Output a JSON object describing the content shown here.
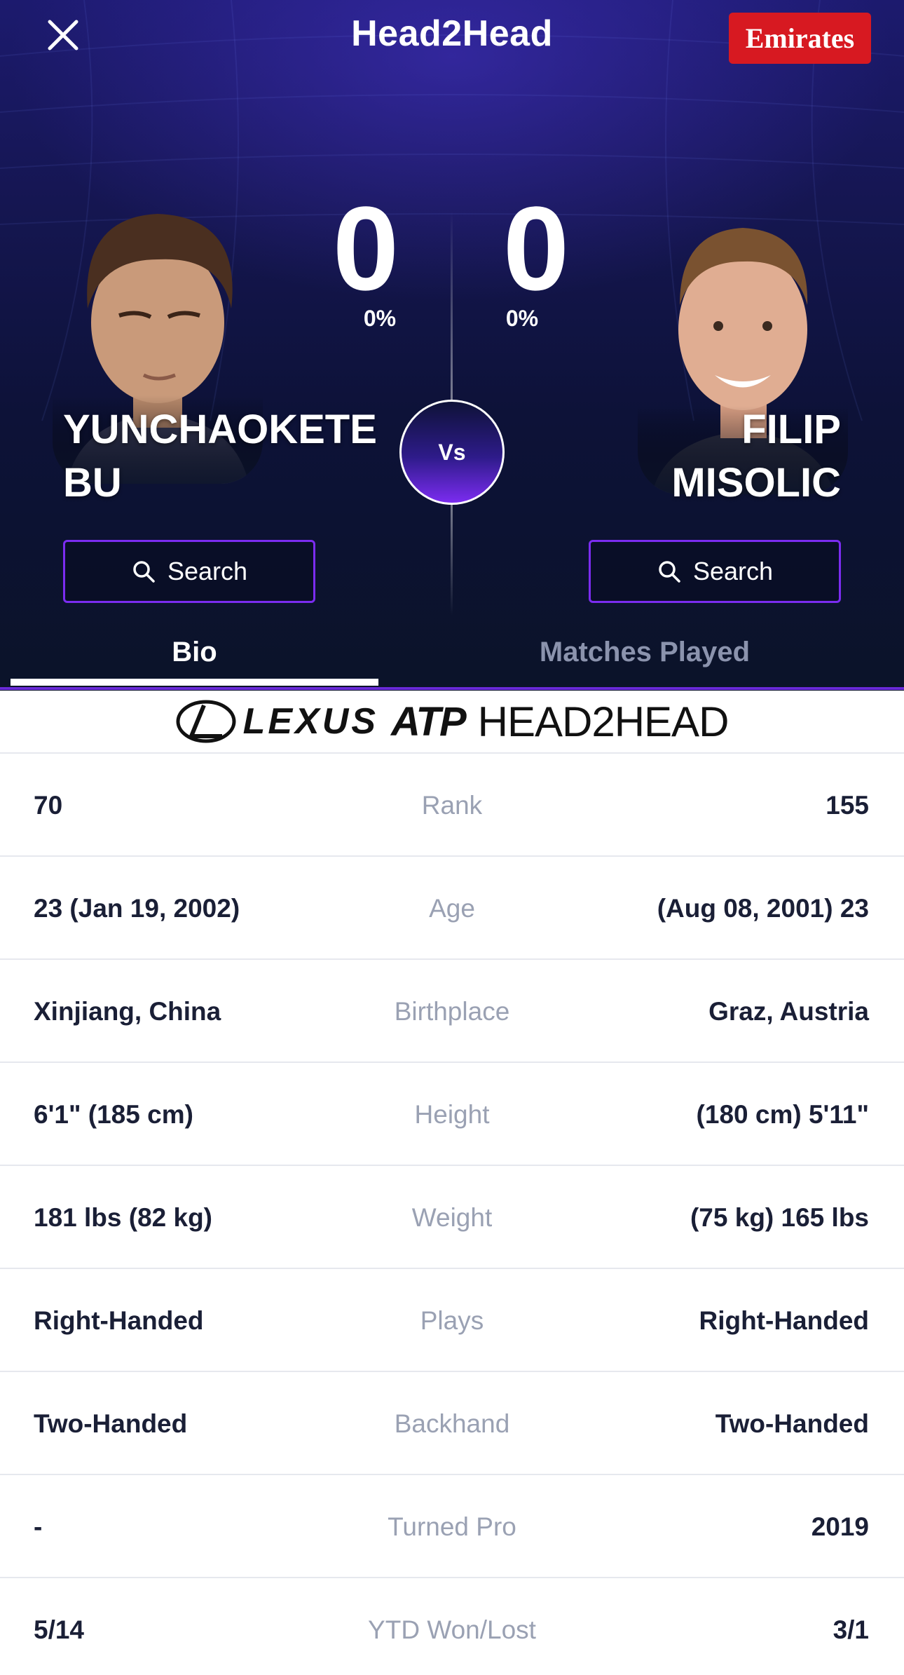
{
  "header": {
    "title": "Head2Head",
    "sponsor": "Emirates",
    "close_icon": "close-icon"
  },
  "colors": {
    "accent": "#7b2cf0",
    "sponsor_red": "#d71921",
    "hero_dark": "#0b1329",
    "label_gray": "#9aa1b3",
    "value_dark": "#1a1f36"
  },
  "players": {
    "left": {
      "name_line1": "YUNCHAOKETE",
      "name_line2": "BU",
      "wins": "0",
      "win_pct": "0%",
      "search_label": "Search"
    },
    "right": {
      "name_line1": "FILIP",
      "name_line2": "MISOLIC",
      "wins": "0",
      "win_pct": "0%",
      "search_label": "Search"
    }
  },
  "vs_label": "Vs",
  "tabs": {
    "bio": "Bio",
    "matches": "Matches Played",
    "active": "bio"
  },
  "banner": {
    "lexus": "LEXUS",
    "atp": "ATP",
    "head2head": "HEAD2HEAD"
  },
  "stats": [
    {
      "left": "70",
      "label": "Rank",
      "right": "155"
    },
    {
      "left": "23 (Jan 19, 2002)",
      "label": "Age",
      "right": "(Aug 08, 2001) 23"
    },
    {
      "left": "Xinjiang, China",
      "label": "Birthplace",
      "right": "Graz, Austria"
    },
    {
      "left": "6'1\" (185 cm)",
      "label": "Height",
      "right": "(180 cm) 5'11\""
    },
    {
      "left": "181 lbs (82 kg)",
      "label": "Weight",
      "right": "(75 kg) 165 lbs"
    },
    {
      "left": "Right-Handed",
      "label": "Plays",
      "right": "Right-Handed"
    },
    {
      "left": "Two-Handed",
      "label": "Backhand",
      "right": "Two-Handed"
    },
    {
      "left": "-",
      "label": "Turned Pro",
      "right": "2019"
    },
    {
      "left": "5/14",
      "label": "YTD Won/Lost",
      "right": "3/1"
    }
  ]
}
